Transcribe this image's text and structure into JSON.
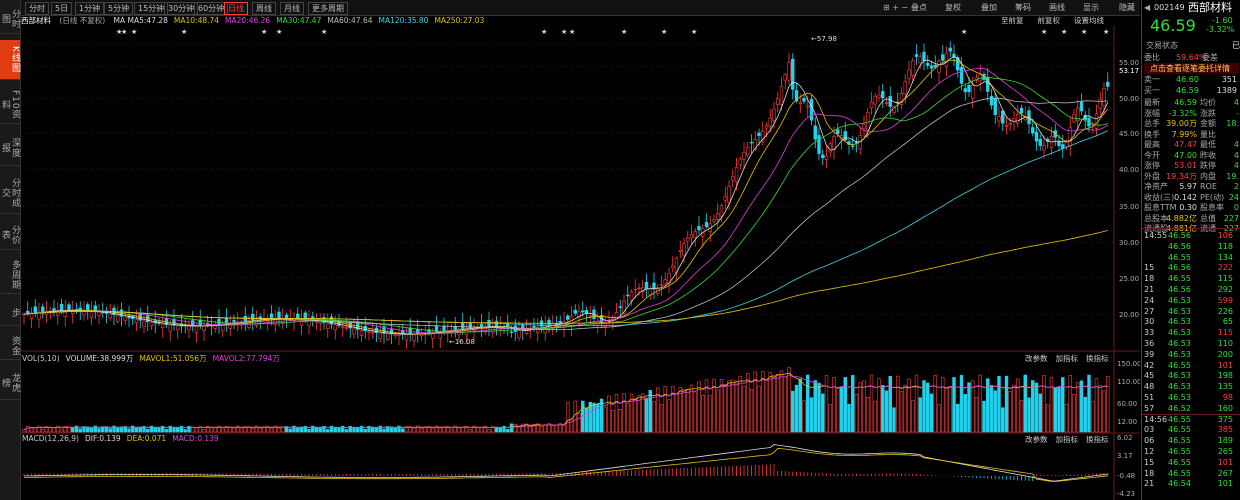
{
  "colors": {
    "up": "#ff3c3c",
    "down": "#22d3ee",
    "accent": "#e03c12"
  },
  "left_tabs": [
    "分时图",
    "K线图",
    "F10资料",
    "深度报",
    "分时成交",
    "分价表",
    "多周期",
    "步",
    "资金",
    "龙虎榜"
  ],
  "toolbar": {
    "period_tabs": [
      "分时",
      "5日",
      "1分钟",
      "5分钟",
      "15分钟",
      "30分钟",
      "60分钟",
      "日线",
      "周线",
      "月线",
      "更多周期"
    ],
    "active_period": "日线",
    "right_items": [
      "叠点",
      "复权",
      "叠加",
      "筹码",
      "画线",
      "显示",
      "隐藏"
    ]
  },
  "infobar": {
    "name": "西部材料",
    "mode": "(日线 不复权)",
    "ma": [
      {
        "text": "MA MA5:47.28",
        "color": "#dddddd"
      },
      {
        "text": "MA10:48.74",
        "color": "#e6c200"
      },
      {
        "text": "MA20:46.26",
        "color": "#e040e0"
      },
      {
        "text": "MA30:47.47",
        "color": "#33dd33"
      },
      {
        "text": "MA60:47.64",
        "color": "#bbbbbb"
      },
      {
        "text": "MA120:35.80",
        "color": "#3bd3e6"
      },
      {
        "text": "MA250:27.03",
        "color": "#e6c200"
      }
    ],
    "right": [
      "至前复",
      "前复权",
      "设置均线"
    ]
  },
  "price_axis": {
    "labels": [
      "55.00",
      "53.17",
      "50.00",
      "45.00",
      "40.00",
      "35.00",
      "30.00",
      "25.00",
      "20.00"
    ],
    "marker_high": "57.98",
    "marker_low": "16.08"
  },
  "vol_header": {
    "title": "VOL(5,10)",
    "items": [
      {
        "text": "VOLUME:38.999万",
        "color": "#dddddd"
      },
      {
        "text": "MAVOL1:51.056万",
        "color": "#e6c200"
      },
      {
        "text": "MAVOL2:77.794万",
        "color": "#e040e0"
      }
    ],
    "right": [
      "改参数",
      "加指标",
      "换指标"
    ]
  },
  "vol_axis": [
    "150.00",
    "110.00",
    "60.00",
    "12.00"
  ],
  "macd_header": {
    "title": "MACD(12,26,9)",
    "items": [
      {
        "text": "DIF:0.139",
        "color": "#dddddd"
      },
      {
        "text": "DEA:0.071",
        "color": "#e6c200"
      },
      {
        "text": "MACD:0.139",
        "color": "#e040e0"
      }
    ],
    "right": [
      "改参数",
      "加指标",
      "换指标"
    ]
  },
  "macd_axis": [
    "6.02",
    "3.17",
    "-0.48",
    "-4.23"
  ],
  "quote": {
    "code": "002149",
    "name": "西部材料",
    "price": "46.59",
    "change": "-1.60",
    "change_pct": "-3.32%",
    "status_label": "交易状态",
    "status_value": "已",
    "rows1": [
      {
        "label": "委比",
        "value": "59.64%",
        "label2": "委差",
        "value2": ""
      },
      {
        "label": "点击查看逐笔委托详情",
        "value": "",
        "label2": "",
        "value2": ""
      },
      {
        "label": "卖一",
        "value": "46.60",
        "label2": "",
        "value2": "351"
      },
      {
        "label": "买一",
        "value": "46.59",
        "label2": "",
        "value2": "1389"
      }
    ],
    "rows2": [
      {
        "label": "最新",
        "value": "46.59",
        "label2": "均价",
        "value2": "4"
      },
      {
        "label": "涨幅",
        "value": "-3.32%",
        "label2": "涨跌",
        "value2": "-"
      },
      {
        "label": "总手",
        "value": "39.00万",
        "label2": "金额",
        "value2": "18."
      },
      {
        "label": "换手",
        "value": "7.99%",
        "label2": "量比",
        "value2": ""
      },
      {
        "label": "最高",
        "value": "47.47",
        "label2": "最低",
        "value2": "4"
      },
      {
        "label": "今开",
        "value": "47.00",
        "label2": "昨收",
        "value2": "4"
      },
      {
        "label": "涨停",
        "value": "53.01",
        "label2": "跌停",
        "value2": "4"
      },
      {
        "label": "外盘",
        "value": "19.34万",
        "label2": "内盘",
        "value2": "19."
      },
      {
        "label": "净资产",
        "value": "5.97",
        "label2": "ROE",
        "value2": "2"
      },
      {
        "label": "收益(三)",
        "value": "0.142",
        "label2": "PE(动)",
        "value2": "24"
      },
      {
        "label": "股息TTM",
        "value": "0.30",
        "label2": "股息率",
        "value2": "0"
      },
      {
        "label": "总股本",
        "value": "4.882亿",
        "label2": "总值",
        "value2": "227"
      },
      {
        "label": "流通股",
        "value": "4.881亿",
        "label2": "流通",
        "value2": "227"
      }
    ],
    "ticks": [
      {
        "time": "14:55",
        "price": "46.56",
        "vol": "106"
      },
      {
        "time": "",
        "price": "46.56",
        "vol": "118"
      },
      {
        "time": "",
        "price": "46.55",
        "vol": "134"
      },
      {
        "time": "15",
        "price": "46.56",
        "vol": "222"
      },
      {
        "time": "18",
        "price": "46.55",
        "vol": "115"
      },
      {
        "time": "21",
        "price": "46.56",
        "vol": "292"
      },
      {
        "time": "24",
        "price": "46.53",
        "vol": "599"
      },
      {
        "time": "27",
        "price": "46.53",
        "vol": "226"
      },
      {
        "time": "30",
        "price": "46.53",
        "vol": "65"
      },
      {
        "time": "33",
        "price": "46.53",
        "vol": "115"
      },
      {
        "time": "36",
        "price": "46.53",
        "vol": "110"
      },
      {
        "time": "39",
        "price": "46.53",
        "vol": "200"
      },
      {
        "time": "42",
        "price": "46.55",
        "vol": "101"
      },
      {
        "time": "45",
        "price": "46.53",
        "vol": "198"
      },
      {
        "time": "48",
        "price": "46.53",
        "vol": "135"
      },
      {
        "time": "51",
        "price": "46.53",
        "vol": "98"
      },
      {
        "time": "57",
        "price": "46.52",
        "vol": "160"
      },
      {
        "time": "14:56",
        "price": "46.55",
        "vol": "375"
      },
      {
        "time": "03",
        "price": "46.55",
        "vol": "385"
      },
      {
        "time": "06",
        "price": "46.55",
        "vol": "189"
      },
      {
        "time": "12",
        "price": "46.55",
        "vol": "265"
      },
      {
        "time": "15",
        "price": "46.55",
        "vol": "101"
      },
      {
        "time": "18",
        "price": "46.55",
        "vol": "267"
      },
      {
        "time": "21",
        "price": "46.54",
        "vol": "101"
      }
    ]
  }
}
